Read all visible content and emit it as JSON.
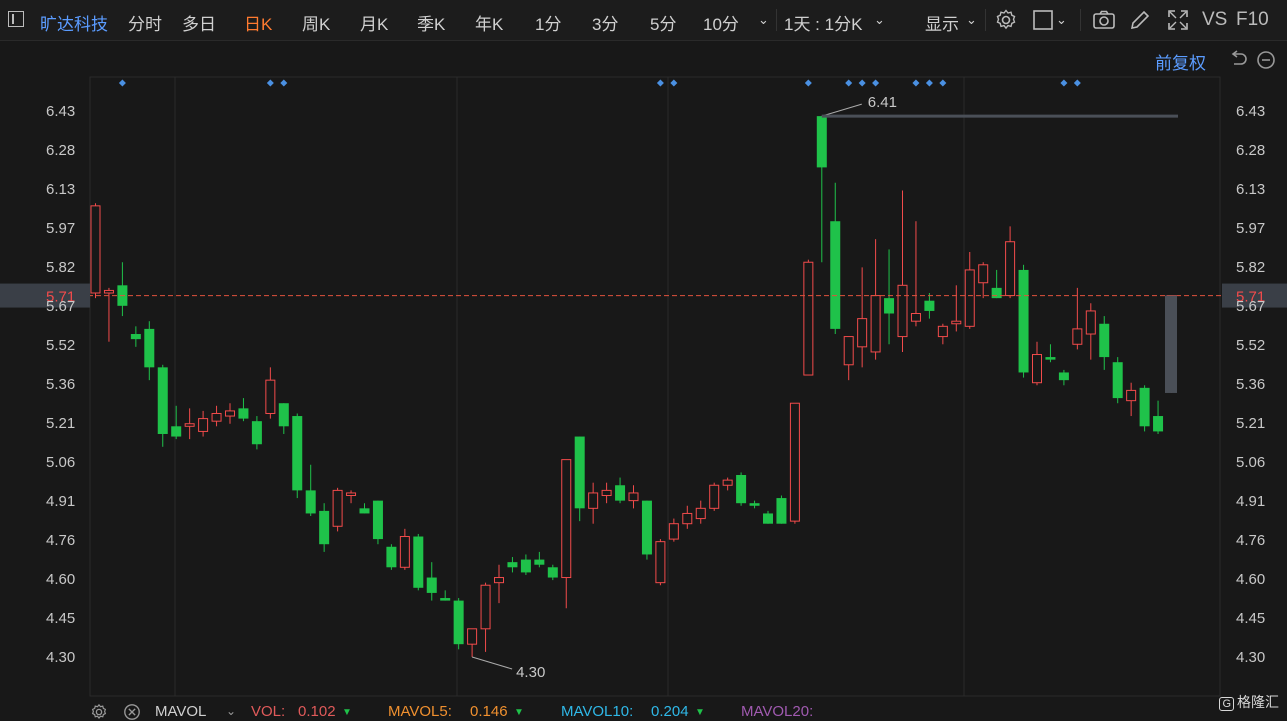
{
  "toolbar": {
    "stock_name": "旷达科技",
    "periods": [
      "分时",
      "多日",
      "日K",
      "周K",
      "月K",
      "季K",
      "年K",
      "1分",
      "3分",
      "5分",
      "10分"
    ],
    "active_period": "日K",
    "multi_period": "1天 : 1分K",
    "display_label": "显示",
    "vs_label": "VS",
    "f10_label": "F10"
  },
  "subbar": {
    "adjust_label": "前复权"
  },
  "colors": {
    "up": "#f24b4b",
    "down": "#1fc24a",
    "accent": "#ff7a2f",
    "link": "#5b9cff",
    "marker": "#4a90e2",
    "price_line": "#e0523d",
    "grid": "#2a2a2a"
  },
  "chart_data": {
    "type": "candlestick",
    "y_ticks": [
      "6.43",
      "6.28",
      "6.13",
      "5.97",
      "5.82",
      "5.67",
      "5.52",
      "5.36",
      "5.21",
      "5.06",
      "4.91",
      "4.76",
      "4.60",
      "4.45",
      "4.30"
    ],
    "ylim": [
      4.23,
      6.55
    ],
    "current_price": "5.71",
    "annotations": [
      {
        "label": "6.41",
        "value": 6.41,
        "type": "high"
      },
      {
        "label": "4.30",
        "value": 4.3,
        "type": "low"
      }
    ],
    "markers_at_candles": [
      2,
      13,
      14,
      42,
      43,
      53,
      56,
      57,
      58,
      61,
      62,
      63,
      72,
      73
    ],
    "candles": [
      {
        "o": 5.72,
        "h": 6.07,
        "l": 5.7,
        "c": 6.06
      },
      {
        "o": 5.72,
        "h": 5.74,
        "l": 5.53,
        "c": 5.73
      },
      {
        "o": 5.75,
        "h": 5.84,
        "l": 5.63,
        "c": 5.67
      },
      {
        "o": 5.56,
        "h": 5.59,
        "l": 5.51,
        "c": 5.54
      },
      {
        "o": 5.58,
        "h": 5.61,
        "l": 5.38,
        "c": 5.43
      },
      {
        "o": 5.43,
        "h": 5.44,
        "l": 5.12,
        "c": 5.17
      },
      {
        "o": 5.2,
        "h": 5.28,
        "l": 5.15,
        "c": 5.16
      },
      {
        "o": 5.2,
        "h": 5.27,
        "l": 5.15,
        "c": 5.21
      },
      {
        "o": 5.18,
        "h": 5.26,
        "l": 5.16,
        "c": 5.23
      },
      {
        "o": 5.22,
        "h": 5.28,
        "l": 5.2,
        "c": 5.25
      },
      {
        "o": 5.24,
        "h": 5.29,
        "l": 5.21,
        "c": 5.26
      },
      {
        "o": 5.27,
        "h": 5.31,
        "l": 5.22,
        "c": 5.23
      },
      {
        "o": 5.22,
        "h": 5.24,
        "l": 5.11,
        "c": 5.13
      },
      {
        "o": 5.25,
        "h": 5.43,
        "l": 5.23,
        "c": 5.38
      },
      {
        "o": 5.29,
        "h": 5.29,
        "l": 5.17,
        "c": 5.2
      },
      {
        "o": 5.24,
        "h": 5.25,
        "l": 4.92,
        "c": 4.95
      },
      {
        "o": 4.95,
        "h": 5.05,
        "l": 4.85,
        "c": 4.86
      },
      {
        "o": 4.87,
        "h": 4.9,
        "l": 4.71,
        "c": 4.74
      },
      {
        "o": 4.81,
        "h": 4.96,
        "l": 4.79,
        "c": 4.95
      },
      {
        "o": 4.93,
        "h": 4.95,
        "l": 4.9,
        "c": 4.94
      },
      {
        "o": 4.88,
        "h": 4.9,
        "l": 4.86,
        "c": 4.86
      },
      {
        "o": 4.91,
        "h": 4.91,
        "l": 4.74,
        "c": 4.76
      },
      {
        "o": 4.73,
        "h": 4.74,
        "l": 4.64,
        "c": 4.65
      },
      {
        "o": 4.65,
        "h": 4.8,
        "l": 4.64,
        "c": 4.77
      },
      {
        "o": 4.77,
        "h": 4.78,
        "l": 4.56,
        "c": 4.57
      },
      {
        "o": 4.61,
        "h": 4.67,
        "l": 4.52,
        "c": 4.55
      },
      {
        "o": 4.53,
        "h": 4.56,
        "l": 4.52,
        "c": 4.52
      },
      {
        "o": 4.52,
        "h": 4.53,
        "l": 4.33,
        "c": 4.35
      },
      {
        "o": 4.35,
        "h": 4.4,
        "l": 4.3,
        "c": 4.41
      },
      {
        "o": 4.41,
        "h": 4.59,
        "l": 4.32,
        "c": 4.58
      },
      {
        "o": 4.59,
        "h": 4.66,
        "l": 4.51,
        "c": 4.61
      },
      {
        "o": 4.67,
        "h": 4.69,
        "l": 4.63,
        "c": 4.65
      },
      {
        "o": 4.68,
        "h": 4.7,
        "l": 4.62,
        "c": 4.63
      },
      {
        "o": 4.68,
        "h": 4.71,
        "l": 4.65,
        "c": 4.66
      },
      {
        "o": 4.65,
        "h": 4.66,
        "l": 4.6,
        "c": 4.61
      },
      {
        "o": 4.61,
        "h": 4.55,
        "l": 4.49,
        "c": 5.07
      },
      {
        "o": 5.16,
        "h": 5.16,
        "l": 4.83,
        "c": 4.88
      },
      {
        "o": 4.88,
        "h": 4.98,
        "l": 4.82,
        "c": 4.94
      },
      {
        "o": 4.93,
        "h": 4.98,
        "l": 4.9,
        "c": 4.95
      },
      {
        "o": 4.97,
        "h": 5.0,
        "l": 4.9,
        "c": 4.91
      },
      {
        "o": 4.91,
        "h": 4.97,
        "l": 4.88,
        "c": 4.94
      },
      {
        "o": 4.91,
        "h": 4.91,
        "l": 4.68,
        "c": 4.7
      },
      {
        "o": 4.59,
        "h": 4.76,
        "l": 4.58,
        "c": 4.75
      },
      {
        "o": 4.76,
        "h": 4.84,
        "l": 4.75,
        "c": 4.82
      },
      {
        "o": 4.82,
        "h": 4.89,
        "l": 4.8,
        "c": 4.86
      },
      {
        "o": 4.84,
        "h": 4.91,
        "l": 4.82,
        "c": 4.88
      },
      {
        "o": 4.88,
        "h": 4.98,
        "l": 4.87,
        "c": 4.97
      },
      {
        "o": 4.97,
        "h": 5.0,
        "l": 4.95,
        "c": 4.99
      },
      {
        "o": 5.01,
        "h": 5.02,
        "l": 4.89,
        "c": 4.9
      },
      {
        "o": 4.9,
        "h": 4.91,
        "l": 4.88,
        "c": 4.89
      },
      {
        "o": 4.86,
        "h": 4.87,
        "l": 4.82,
        "c": 4.82
      },
      {
        "o": 4.92,
        "h": 4.93,
        "l": 4.82,
        "c": 4.82
      },
      {
        "o": 4.83,
        "h": 5.29,
        "l": 4.82,
        "c": 5.29
      },
      {
        "o": 5.4,
        "h": 5.85,
        "l": 5.4,
        "c": 5.84
      },
      {
        "o": 6.41,
        "h": 6.41,
        "l": 5.84,
        "c": 6.21
      },
      {
        "o": 6.0,
        "h": 6.15,
        "l": 5.56,
        "c": 5.58
      },
      {
        "o": 5.44,
        "h": 5.55,
        "l": 5.38,
        "c": 5.55
      },
      {
        "o": 5.51,
        "h": 5.82,
        "l": 5.43,
        "c": 5.62
      },
      {
        "o": 5.49,
        "h": 5.93,
        "l": 5.46,
        "c": 5.71
      },
      {
        "o": 5.7,
        "h": 5.89,
        "l": 5.52,
        "c": 5.64
      },
      {
        "o": 5.55,
        "h": 6.12,
        "l": 5.49,
        "c": 5.75
      },
      {
        "o": 5.61,
        "h": 6.0,
        "l": 5.59,
        "c": 5.64
      },
      {
        "o": 5.69,
        "h": 5.72,
        "l": 5.62,
        "c": 5.65
      },
      {
        "o": 5.55,
        "h": 5.6,
        "l": 5.52,
        "c": 5.59
      },
      {
        "o": 5.6,
        "h": 5.75,
        "l": 5.57,
        "c": 5.61
      },
      {
        "o": 5.59,
        "h": 5.88,
        "l": 5.58,
        "c": 5.81
      },
      {
        "o": 5.76,
        "h": 5.84,
        "l": 5.7,
        "c": 5.83
      },
      {
        "o": 5.74,
        "h": 5.81,
        "l": 5.71,
        "c": 5.7
      },
      {
        "o": 5.71,
        "h": 5.98,
        "l": 5.7,
        "c": 5.92
      },
      {
        "o": 5.81,
        "h": 5.83,
        "l": 5.39,
        "c": 5.41
      },
      {
        "o": 5.37,
        "h": 5.53,
        "l": 5.36,
        "c": 5.48
      },
      {
        "o": 5.47,
        "h": 5.52,
        "l": 5.45,
        "c": 5.46
      },
      {
        "o": 5.41,
        "h": 5.42,
        "l": 5.36,
        "c": 5.38
      },
      {
        "o": 5.52,
        "h": 5.74,
        "l": 5.5,
        "c": 5.58
      },
      {
        "o": 5.56,
        "h": 5.68,
        "l": 5.46,
        "c": 5.65
      },
      {
        "o": 5.6,
        "h": 5.63,
        "l": 5.42,
        "c": 5.47
      },
      {
        "o": 5.45,
        "h": 5.47,
        "l": 5.29,
        "c": 5.31
      },
      {
        "o": 5.3,
        "h": 5.37,
        "l": 5.24,
        "c": 5.34
      },
      {
        "o": 5.35,
        "h": 5.36,
        "l": 5.18,
        "c": 5.2
      },
      {
        "o": 5.24,
        "h": 5.3,
        "l": 5.17,
        "c": 5.18
      },
      {
        "o": 5.34,
        "h": 5.71,
        "l": 5.33,
        "c": 5.71
      }
    ]
  },
  "bottom": {
    "indicator": "MAVOL",
    "vol_label": "VOL:",
    "vol_value": "0.102",
    "mavol5_label": "MAVOL5:",
    "mavol5_value": "0.146",
    "mavol10_label": "MAVOL10:",
    "mavol10_value": "0.204",
    "mavol20_label": "MAVOL20:",
    "vol_color": "#e05a5a",
    "mavol5_color": "#f0902f",
    "mavol10_color": "#2fb8e8",
    "mavol20_color": "#a05ab0",
    "watermark": "格隆汇"
  }
}
